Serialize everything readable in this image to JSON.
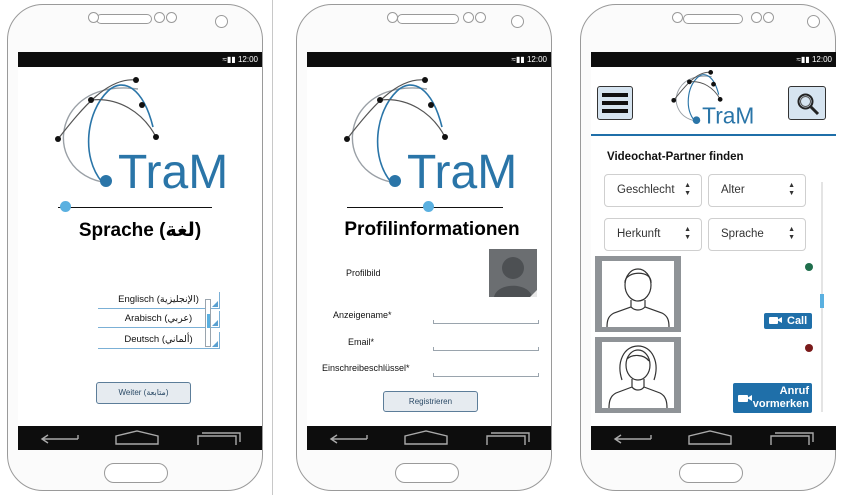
{
  "colors": {
    "accent": "#1f6fa9",
    "logo_blue": "#2a75a8",
    "online": "#1f6e4c",
    "offline": "#7a1a1a",
    "slider": "#5ab0e0"
  },
  "status_bar": {
    "time": "12:00"
  },
  "logo": {
    "text": "TraM"
  },
  "screen1": {
    "title": "Sprache (لغة)",
    "languages": [
      "Englisch (الإنجليزية)",
      "Arabisch (عربي)",
      "Deutsch (ألماني)"
    ],
    "next_button": "Weiter (متابعة)"
  },
  "screen2": {
    "title": "Profilinformationen",
    "profile_picture_label": "Profilbild",
    "fields": [
      {
        "label": "Anzeigename*",
        "value": ""
      },
      {
        "label": "Email*",
        "value": ""
      },
      {
        "label": "Einschreibeschlüssel*",
        "value": ""
      }
    ],
    "register_button": "Registrieren"
  },
  "screen3": {
    "heading": "Videochat-Partner finden",
    "filters": [
      "Geschlecht",
      "Alter",
      "Herkunft",
      "Sprache"
    ],
    "partners": [
      {
        "status": "online",
        "action": "Call"
      },
      {
        "status": "offline",
        "action_line1": "Anruf",
        "action_line2": "vormerken"
      }
    ]
  }
}
